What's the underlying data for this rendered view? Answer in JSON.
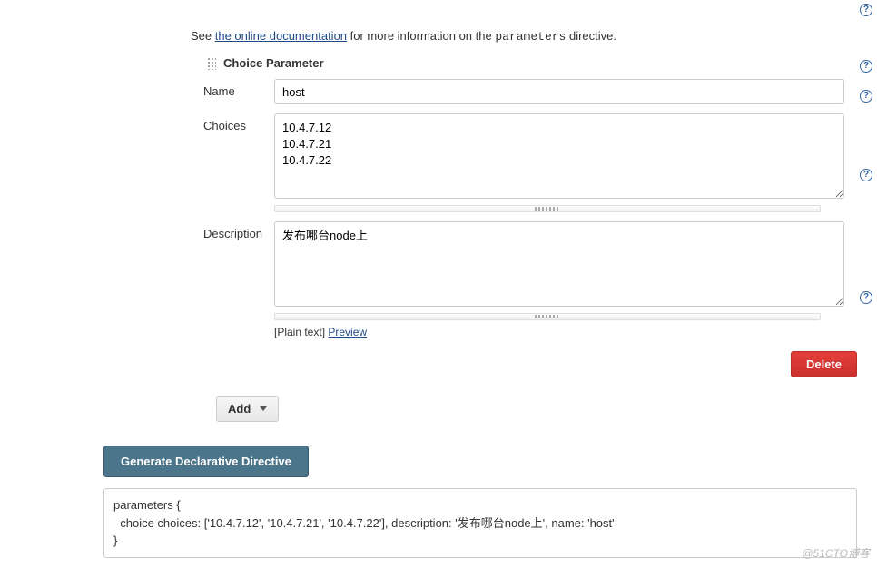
{
  "info": {
    "prefix": "See ",
    "link": "the online documentation",
    "mid": " for more information on the ",
    "param_word": "parameters",
    "suffix": " directive."
  },
  "param": {
    "header": "Choice Parameter",
    "labels": {
      "name": "Name",
      "choices": "Choices",
      "description": "Description"
    },
    "values": {
      "name": "host",
      "choices": "10.4.7.12\n10.4.7.21\n10.4.7.22",
      "description": "发布哪台node上"
    },
    "desc_meta_plain": "[Plain text] ",
    "desc_meta_preview": "Preview"
  },
  "buttons": {
    "delete": "Delete",
    "add": "Add",
    "generate": "Generate Declarative Directive"
  },
  "output": "parameters {\n  choice choices: ['10.4.7.12', '10.4.7.21', '10.4.7.22'], description: '发布哪台node上', name: 'host'\n}",
  "watermark": "@51CTO博客"
}
